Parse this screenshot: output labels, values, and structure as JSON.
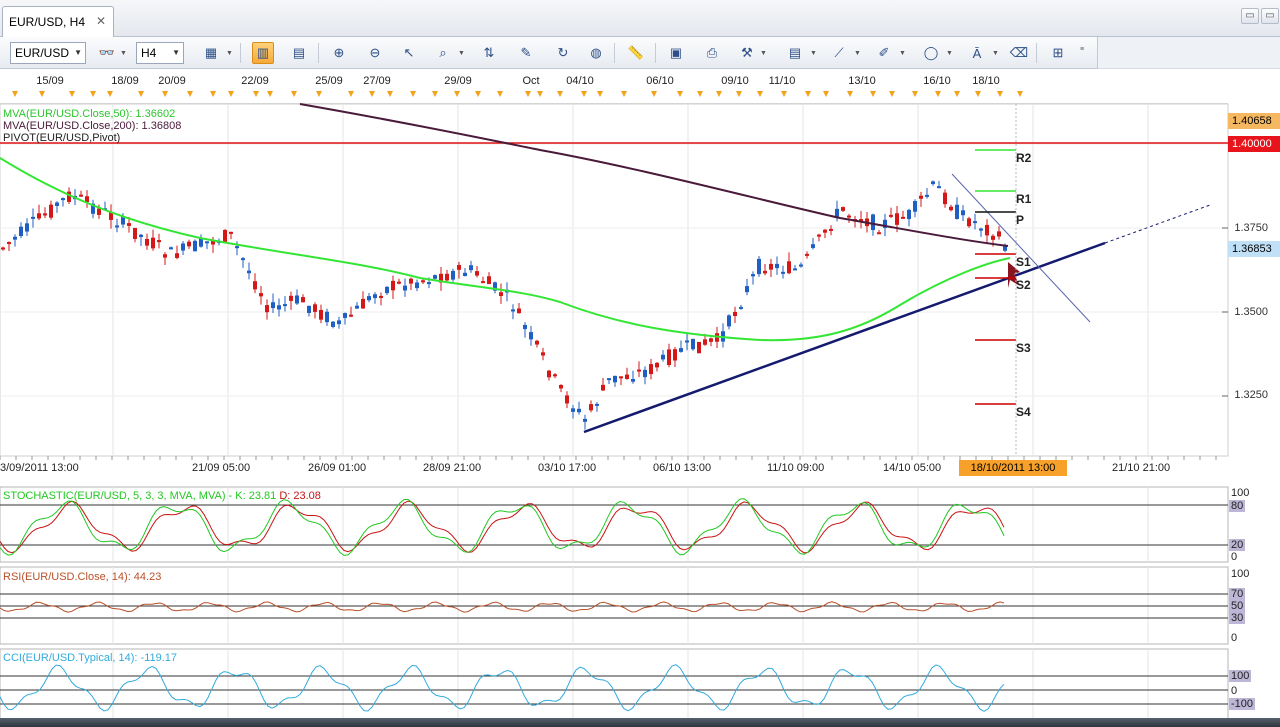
{
  "tab": {
    "title": "EUR/USD, H4",
    "close": "✕"
  },
  "window_buttons": [
    "▭",
    "▭"
  ],
  "toolbar": {
    "symbol": "EUR/USD",
    "timeframe": "H4"
  },
  "top_axis": {
    "dates": [
      "15/09",
      "18/09",
      "20/09",
      "22/09",
      "25/09",
      "27/09",
      "29/09",
      "Oct",
      "04/10",
      "06/10",
      "09/10",
      "11/10",
      "13/10",
      "16/10",
      "18/10"
    ]
  },
  "legend": {
    "ma50": "MVA(EUR/USD.Close,50): 1.36602",
    "ma200": "MVA(EUR/USD.Close,200): 1.36808",
    "pivot": "PIVOT(EUR/USD,Pivot)"
  },
  "price_axis": {
    "labels": [
      "1.3750",
      "1.3500",
      "1.3250"
    ],
    "box_top": "1.40658",
    "box_red": "1.40000",
    "box_current": "1.36853"
  },
  "pivot_labels": [
    "R2",
    "R1",
    "P",
    "S1",
    "S2",
    "S3",
    "S4"
  ],
  "time_axis": {
    "labels": [
      "3/09/2011 13:00",
      "21/09 05:00",
      "26/09 01:00",
      "28/09 21:00",
      "03/10 17:00",
      "06/10 13:00",
      "11/10 09:00",
      "14/10 05:00",
      "21/10 21:00"
    ],
    "highlight": "18/10/2011 13:00"
  },
  "stochastic": {
    "title": "STOCHASTIC(EUR/USD, 5, 3, 3, MVA, MVA) -",
    "k": "K: 23.81",
    "d": "D: 23.08",
    "scale": [
      "100",
      "80",
      "20",
      "0"
    ]
  },
  "rsi": {
    "title": "RSI(EUR/USD.Close, 14): 44.23",
    "scale": [
      "100",
      "70",
      "50",
      "30",
      "0"
    ]
  },
  "cci": {
    "title": "CCI(EUR/USD.Typical, 14): -119.17",
    "scale": [
      "100",
      "0",
      "-100"
    ]
  },
  "colors": {
    "ma50": "#33e633",
    "ma200": "#4a1a3a",
    "pivot": "#e01010",
    "bull": "#1f5fc4",
    "bear": "#d41717",
    "trend": "#141a6e",
    "stoch_k": "#22c722",
    "stoch_d": "#c81414",
    "rsi": "#b8502a",
    "cci": "#33aadd",
    "highlight": "#f7a12a"
  }
}
